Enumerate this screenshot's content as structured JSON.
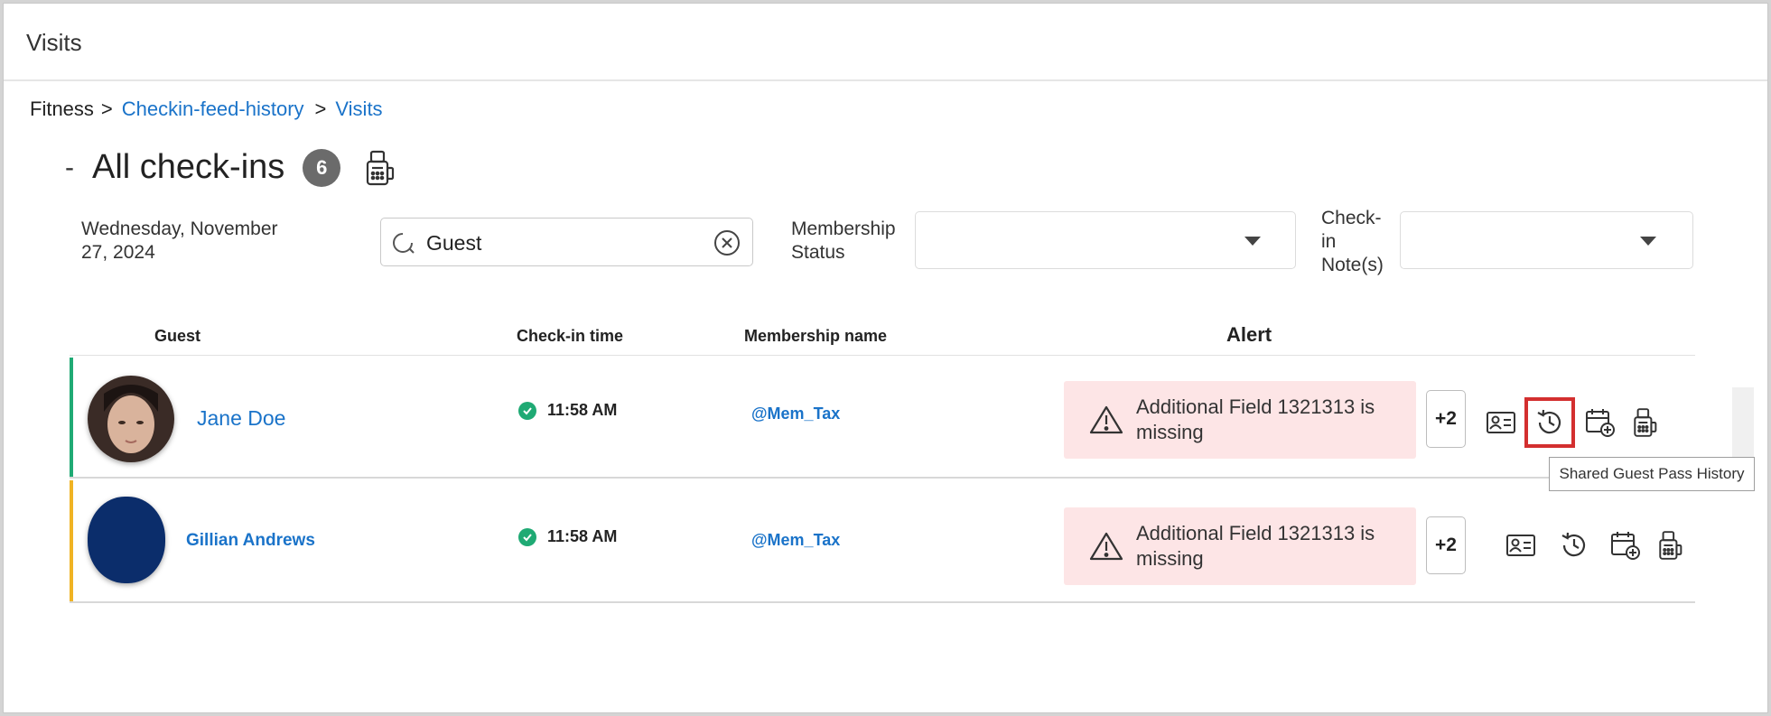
{
  "window": {
    "title": "Visits"
  },
  "breadcrumb": {
    "root": "Fitness",
    "separator": ">",
    "link1": "Checkin-feed-history",
    "link2": "Visits"
  },
  "heading": {
    "collapse_symbol": "-",
    "title": "All check-ins",
    "count": "6",
    "kiosk_icon": "kiosk-icon"
  },
  "filters": {
    "date": "Wednesday, November 27, 2024",
    "search": {
      "value": "Guest",
      "icon": "search-icon",
      "clear_icon": "clear-circle-icon"
    },
    "membership_status": {
      "label": "Membership Status",
      "value": ""
    },
    "checkin_notes": {
      "label": "Check-in Note(s)",
      "value": ""
    }
  },
  "table": {
    "headers": {
      "guest": "Guest",
      "checkin_time": "Check-in time",
      "membership_name": "Membership name",
      "alert": "Alert"
    },
    "rows": [
      {
        "name": "Jane Doe",
        "time": "11:58 AM",
        "membership": "@Mem_Tax",
        "alert": "Additional Field 1321313 is missing",
        "more": "+2",
        "accent_color": "#1faa74",
        "actions": [
          "id-card-icon",
          "history-icon",
          "calendar-add-icon",
          "kiosk-icon"
        ]
      },
      {
        "name": "Gillian Andrews",
        "time": "11:58 AM",
        "membership": "@Mem_Tax",
        "alert": "Additional Field 1321313 is missing",
        "more": "+2",
        "accent_color": "#f0b323",
        "avatar_color": "#0b2d6b",
        "actions": [
          "id-card-icon",
          "history-icon",
          "calendar-add-icon",
          "kiosk-icon"
        ]
      }
    ]
  },
  "tooltip": {
    "text": "Shared Guest Pass History"
  },
  "colors": {
    "link": "#1a73c9",
    "alert_bg": "#fde5e6",
    "highlight": "#d32f2f",
    "badge": "#6b6b6b"
  }
}
